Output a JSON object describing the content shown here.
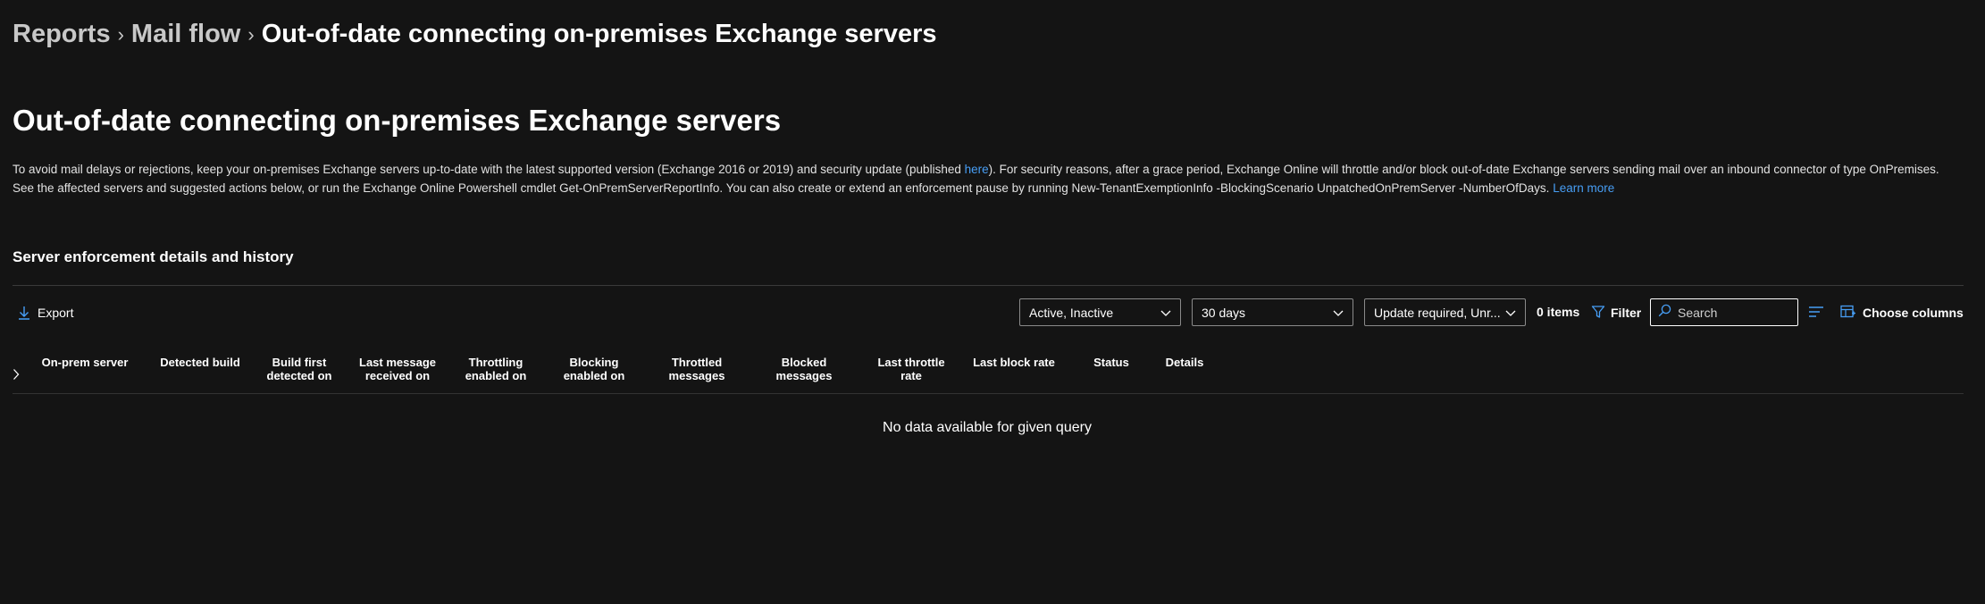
{
  "breadcrumb": {
    "items": [
      "Reports",
      "Mail flow",
      "Out-of-date connecting on-premises Exchange servers"
    ],
    "separator": "›"
  },
  "page": {
    "title": "Out-of-date connecting on-premises Exchange servers",
    "description": {
      "text1": "To avoid mail delays or rejections, keep your on-premises Exchange servers up-to-date with the latest supported version (Exchange 2016 or 2019) and security update (published ",
      "link_here": "here",
      "text2": "). For security reasons, after a grace period, Exchange Online will throttle and/or block out-of-date Exchange servers sending mail over an inbound connector of type OnPremises. See the affected servers and suggested actions below, or run the Exchange Online Powershell cmdlet Get-OnPremServerReportInfo. You can also create or extend an enforcement pause by running New-TenantExemptionInfo -BlockingScenario UnpatchedOnPremServer -NumberOfDays. ",
      "link_learn_more": "Learn more"
    }
  },
  "section": {
    "title": "Server enforcement details and history"
  },
  "toolbar": {
    "export_label": "Export",
    "status_filter": "Active, Inactive",
    "date_range": "30 days",
    "update_filter": "Update required, Unr...",
    "items_count": "0 items",
    "filter_label": "Filter",
    "search_placeholder": "Search",
    "choose_columns_label": "Choose columns"
  },
  "table": {
    "columns": [
      "On-prem server",
      "Detected build",
      "Build first\ndetected on",
      "Last message\nreceived on",
      "Throttling\nenabled on",
      "Blocking\nenabled on",
      "Throttled\nmessages",
      "Blocked\nmessages",
      "Last throttle\nrate",
      "Last block rate",
      "Status",
      "Details"
    ],
    "empty_message": "No data available for given query"
  },
  "colors": {
    "background": "#141414",
    "text": "#ffffff",
    "link": "#479ef5",
    "accent_icon": "#479ef5",
    "border": "#8a8a8a"
  },
  "icons": {
    "export": "download-arrow-icon",
    "filter": "funnel-icon",
    "search": "search-icon",
    "density": "density-lines-icon",
    "choose_columns": "table-columns-icon",
    "expand": "chevron-right-icon",
    "dropdown": "chevron-down-icon"
  }
}
